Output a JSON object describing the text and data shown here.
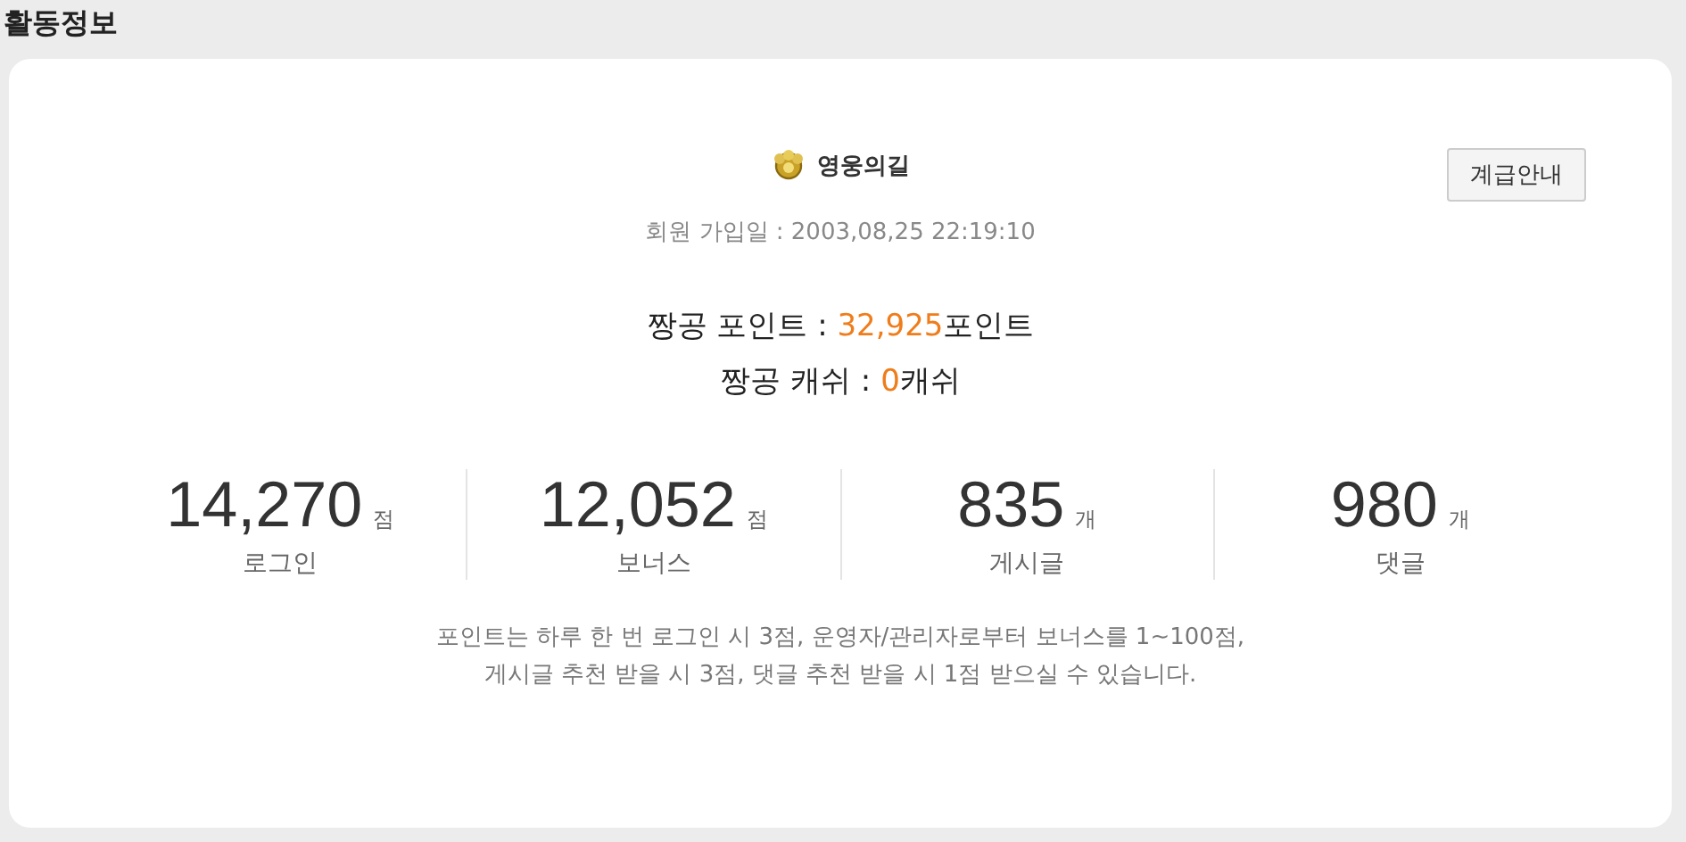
{
  "section_title": "활동정보",
  "rank": {
    "name": "영웅의길"
  },
  "rank_button": "계급안내",
  "join_date": "회원 가입일 : 2003,08,25 22:19:10",
  "balances": [
    {
      "label": "짱공 포인트 : ",
      "value": "32,925",
      "unit": "포인트"
    },
    {
      "label": "짱공 캐쉬 : ",
      "value": "0",
      "unit": "캐쉬"
    }
  ],
  "stats": [
    {
      "value": "14,270",
      "unit": "점",
      "label": "로그인"
    },
    {
      "value": "12,052",
      "unit": "점",
      "label": "보너스"
    },
    {
      "value": "835",
      "unit": "개",
      "label": "게시글"
    },
    {
      "value": "980",
      "unit": "개",
      "label": "댓글"
    }
  ],
  "note_lines": [
    "포인트는 하루 한 번 로그인 시 3점, 운영자/관리자로부터 보너스를 1~100점,",
    "게시글 추천 받을 시 3점, 댓글 추천 받을 시 1점 받으실 수 있습니다."
  ]
}
